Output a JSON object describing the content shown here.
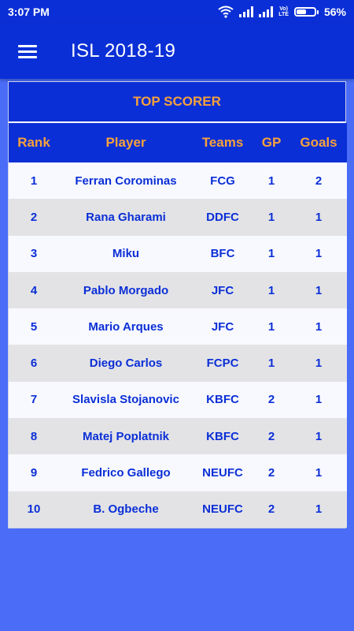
{
  "status_bar": {
    "time": "3:07 PM",
    "network_label_top": "Vo)",
    "network_label_bottom": "LTE",
    "battery_percent": "56%",
    "battery_level": 0.56,
    "icons": [
      "wifi-icon",
      "signal-icon",
      "signal-icon",
      "battery-icon"
    ]
  },
  "app_bar": {
    "title": "ISL 2018-19",
    "menu_icon": "menu-icon"
  },
  "card": {
    "title": "TOP SCORER",
    "columns": [
      "Rank",
      "Player",
      "Teams",
      "GP",
      "Goals"
    ],
    "rows": [
      {
        "rank": "1",
        "player": "Ferran Corominas",
        "team": "FCG",
        "gp": "1",
        "goals": "2"
      },
      {
        "rank": "2",
        "player": "Rana Gharami",
        "team": "DDFC",
        "gp": "1",
        "goals": "1"
      },
      {
        "rank": "3",
        "player": "Miku",
        "team": "BFC",
        "gp": "1",
        "goals": "1"
      },
      {
        "rank": "4",
        "player": "Pablo Morgado",
        "team": "JFC",
        "gp": "1",
        "goals": "1"
      },
      {
        "rank": "5",
        "player": "Mario Arques",
        "team": "JFC",
        "gp": "1",
        "goals": "1"
      },
      {
        "rank": "6",
        "player": "Diego Carlos",
        "team": "FCPC",
        "gp": "1",
        "goals": "1"
      },
      {
        "rank": "7",
        "player": "Slavisla Stojanovic",
        "team": "KBFC",
        "gp": "2",
        "goals": "1"
      },
      {
        "rank": "8",
        "player": "Matej Poplatnik",
        "team": "KBFC",
        "gp": "2",
        "goals": "1"
      },
      {
        "rank": "9",
        "player": "Fedrico Gallego",
        "team": "NEUFC",
        "gp": "2",
        "goals": "1"
      },
      {
        "rank": "10",
        "player": "B. Ogbeche",
        "team": "NEUFC",
        "gp": "2",
        "goals": "1"
      }
    ]
  },
  "colors": {
    "primary": "#0b2fd6",
    "accent": "#f7a23b",
    "background": "#4a6cf7",
    "row_light": "#f8f9ff",
    "row_dark": "#e3e3e6"
  }
}
